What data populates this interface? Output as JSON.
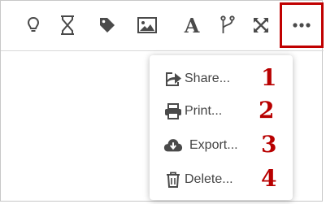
{
  "toolbar": {
    "tools": [
      {
        "icon": "lightbulb-icon"
      },
      {
        "icon": "hourglass-icon"
      },
      {
        "icon": "tag-icon"
      },
      {
        "icon": "image-icon"
      },
      {
        "icon": "font-icon",
        "glyph": "A"
      },
      {
        "icon": "branch-icon"
      },
      {
        "icon": "expand-icon"
      }
    ],
    "more": {
      "icon": "ellipsis-icon",
      "glyph": "···",
      "highlight_color": "#c00000"
    }
  },
  "menu": {
    "items": [
      {
        "label": "Share...",
        "icon": "share-icon",
        "annotation": "1"
      },
      {
        "label": "Print...",
        "icon": "print-icon",
        "annotation": "2"
      },
      {
        "label": "Export...",
        "icon": "cloud-download-icon",
        "annotation": "3"
      },
      {
        "label": "Delete...",
        "icon": "trash-icon",
        "annotation": "4"
      }
    ]
  },
  "colors": {
    "icon": "#4a4a4a",
    "annotation": "#b80000",
    "highlight": "#c00000"
  }
}
